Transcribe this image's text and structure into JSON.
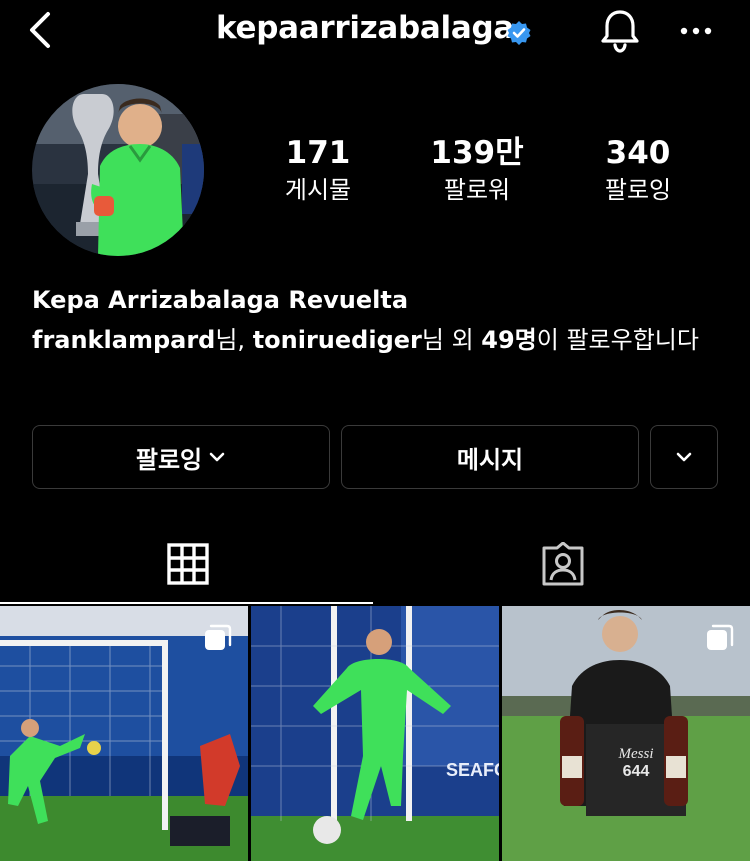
{
  "header": {
    "username": "kepaarrizabalaga",
    "verified_icon": "verified-badge-icon",
    "back_icon": "chevron-left-icon",
    "notifications_icon": "bell-icon",
    "more_icon": "more-horizontal-icon"
  },
  "profile": {
    "stats": [
      {
        "value": "171",
        "label": "게시물"
      },
      {
        "value": "139만",
        "label": "팔로워"
      },
      {
        "value": "340",
        "label": "팔로잉"
      }
    ],
    "full_name": "Kepa Arrizabalaga Revuelta",
    "followed_by": {
      "user1": "franklampard",
      "suffix1": "님, ",
      "user2": "toniruediger",
      "suffix2": "님 외 ",
      "count": "49명",
      "suffix3": "이 팔로우합니다"
    }
  },
  "actions": {
    "following_label": "팔로잉",
    "message_label": "메시지",
    "suggest_icon": "chevron-down-icon"
  },
  "tabs": [
    {
      "icon": "grid-icon",
      "active": true
    },
    {
      "icon": "tagged-person-icon",
      "active": false
    }
  ],
  "posts": [
    {
      "icon": "multiple-posts-icon"
    },
    {
      "icon": "multiple-posts-icon"
    },
    {
      "icon": "multiple-posts-icon",
      "overlay_title": "Messi",
      "overlay_number": "644"
    }
  ],
  "colors": {
    "background": "#000000",
    "verified": "#3897f0",
    "border": "#3a3a3a",
    "keeper_green": "#3fe05a"
  }
}
